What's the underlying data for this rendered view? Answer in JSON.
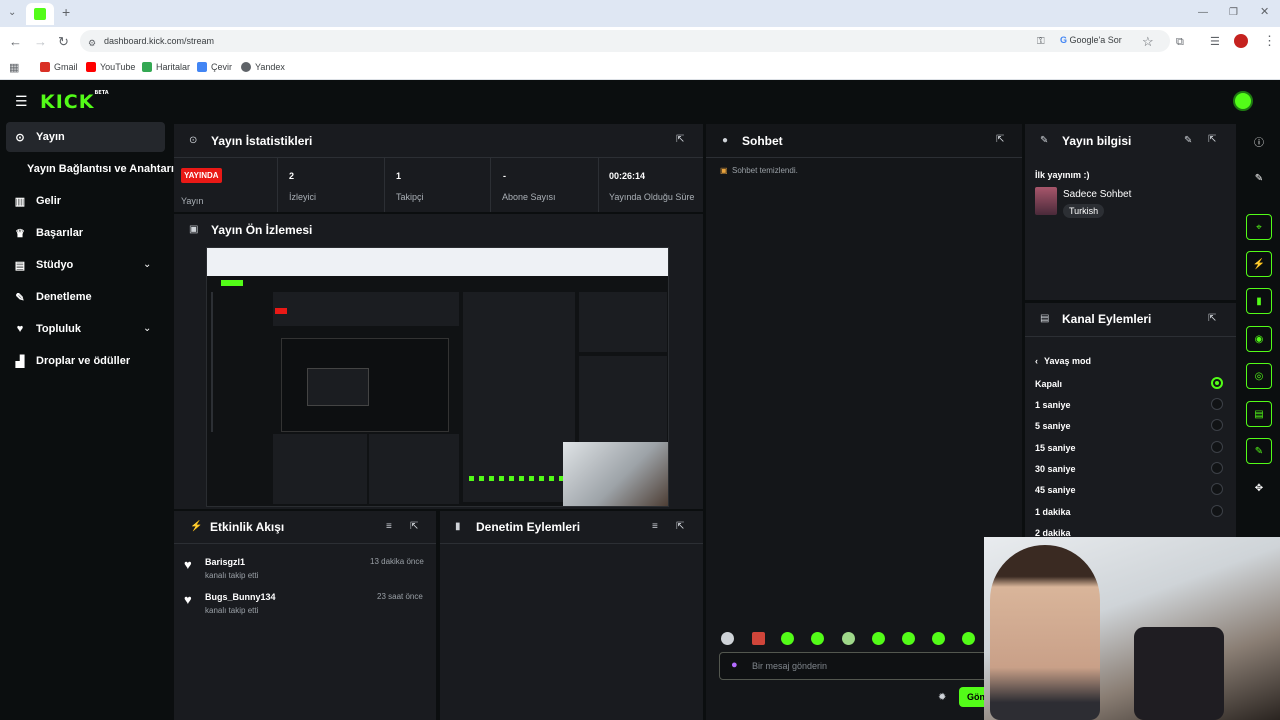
{
  "browser": {
    "url": "dashboard.kick.com/stream",
    "google_button": "Google'a Sor",
    "bookmarks": [
      {
        "label": "Gmail",
        "color": "#d93025"
      },
      {
        "label": "YouTube",
        "color": "#ff0000"
      },
      {
        "label": "Haritalar",
        "color": "#34a853"
      },
      {
        "label": "Çevir",
        "color": "#4285f4"
      },
      {
        "label": "Yandex",
        "color": "#5f6368"
      }
    ]
  },
  "brand": {
    "logo": "KICK",
    "beta": "BETA"
  },
  "sidebar": {
    "items": [
      {
        "label": "Yayın",
        "icon": "broadcast-icon",
        "active": true
      },
      {
        "label": "Yayın Bağlantısı ve Anahtarı",
        "icon": ""
      },
      {
        "label": "Gelir",
        "icon": "revenue-icon"
      },
      {
        "label": "Başarılar",
        "icon": "trophy-icon"
      },
      {
        "label": "Stüdyo",
        "icon": "studio-icon",
        "expandable": true
      },
      {
        "label": "Denetleme",
        "icon": "wrench-icon"
      },
      {
        "label": "Topluluk",
        "icon": "community-icon",
        "expandable": true
      },
      {
        "label": "Droplar ve ödüller",
        "icon": "drops-icon"
      }
    ]
  },
  "stats": {
    "title": "Yayın İstatistikleri",
    "live_badge": "YAYINDA",
    "live_label": "Yayın",
    "items": [
      {
        "value": "2",
        "label": "İzleyici"
      },
      {
        "value": "1",
        "label": "Takipçi"
      },
      {
        "value": "-",
        "label": "Abone Sayısı"
      },
      {
        "value": "00:26:14",
        "label": "Yayında Olduğu Süre"
      }
    ]
  },
  "preview": {
    "title": "Yayın Ön İzlemesi"
  },
  "activity": {
    "title": "Etkinlik Akışı",
    "events": [
      {
        "user": "Barisgzl1",
        "action": "kanalı takip etti",
        "time": "13 dakika önce"
      },
      {
        "user": "Bugs_Bunny134",
        "action": "kanalı takip etti",
        "time": "23 saat önce"
      }
    ]
  },
  "moderation": {
    "title": "Denetim Eylemleri"
  },
  "chat": {
    "title": "Sohbet",
    "system_message": "Sohbet temizlendi.",
    "input_placeholder": "Bir mesaj gönderin",
    "send_label": "Gönder"
  },
  "stream_info": {
    "title": "Yayın bilgisi",
    "stream_title": "İlk yayınım :)",
    "category": "Sadece Sohbet",
    "tag": "Turkish"
  },
  "channel_actions": {
    "title": "Kanal Eylemleri",
    "back_label": "Yavaş mod",
    "options": [
      {
        "label": "Kapalı",
        "selected": true
      },
      {
        "label": "1 saniye",
        "selected": false
      },
      {
        "label": "5 saniye",
        "selected": false
      },
      {
        "label": "15 saniye",
        "selected": false
      },
      {
        "label": "30 saniye",
        "selected": false
      },
      {
        "label": "45 saniye",
        "selected": false
      },
      {
        "label": "1 dakika",
        "selected": false
      },
      {
        "label": "2 dakika",
        "selected": false
      }
    ]
  },
  "colors": {
    "accent": "#53fc18",
    "live": "#e91916",
    "panel": "#191b1f",
    "background": "#0b0e0f"
  }
}
